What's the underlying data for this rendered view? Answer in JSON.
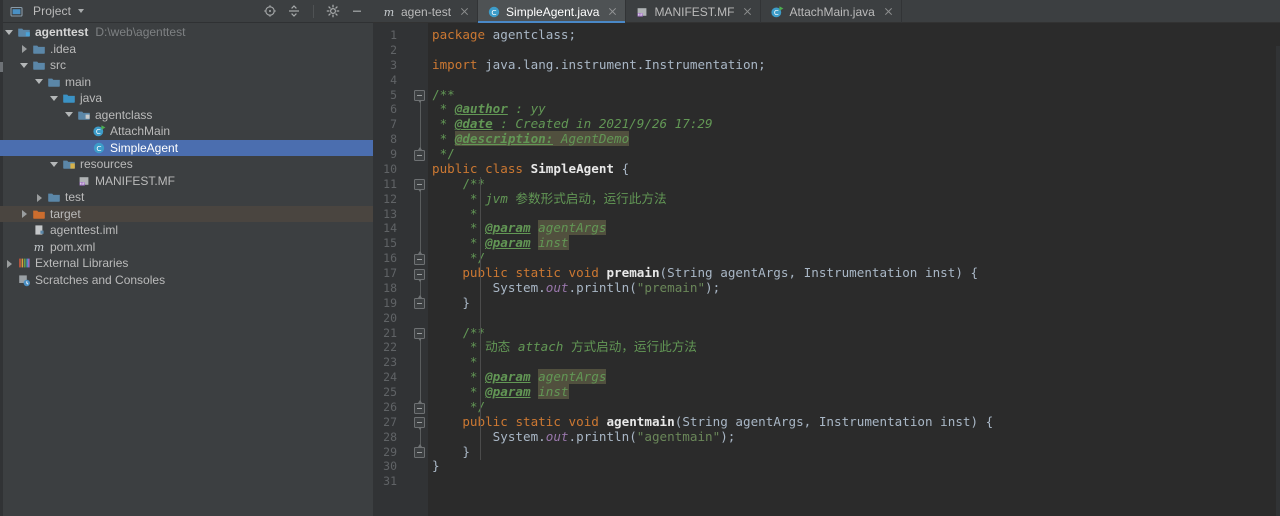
{
  "window": {
    "theme_bg": "#3c3f41",
    "editor_bg": "#2b2b2b",
    "accent": "#4b6eaf"
  },
  "sidebar": {
    "title": "Project",
    "actions": [
      {
        "name": "locate-icon",
        "tooltip": "Select Opened File"
      },
      {
        "name": "collapse-all-icon",
        "tooltip": "Collapse All"
      },
      {
        "name": "gear-icon",
        "tooltip": "Settings"
      },
      {
        "name": "minimize-icon",
        "tooltip": "Hide"
      }
    ],
    "tree": [
      {
        "label": "agenttest",
        "sub": "D:\\web\\agenttest",
        "depth": 0,
        "arrow": "open",
        "icon": "module-icon",
        "state": "bold"
      },
      {
        "label": ".idea",
        "sub": "",
        "depth": 1,
        "arrow": "closed",
        "icon": "folder-icon",
        "state": "normal"
      },
      {
        "label": "src",
        "sub": "",
        "depth": 1,
        "arrow": "open",
        "icon": "folder-icon",
        "state": "normal"
      },
      {
        "label": "main",
        "sub": "",
        "depth": 2,
        "arrow": "open",
        "icon": "folder-icon",
        "state": "normal"
      },
      {
        "label": "java",
        "sub": "",
        "depth": 3,
        "arrow": "open",
        "icon": "source-root-icon",
        "state": "normal"
      },
      {
        "label": "agentclass",
        "sub": "",
        "depth": 4,
        "arrow": "open",
        "icon": "package-icon",
        "state": "normal"
      },
      {
        "label": "AttachMain",
        "sub": "",
        "depth": 5,
        "arrow": "none",
        "icon": "java-class-runnable-icon",
        "state": "normal"
      },
      {
        "label": "SimpleAgent",
        "sub": "",
        "depth": 5,
        "arrow": "none",
        "icon": "java-class-icon",
        "state": "selected"
      },
      {
        "label": "resources",
        "sub": "",
        "depth": 3,
        "arrow": "open",
        "icon": "resource-root-icon",
        "state": "normal"
      },
      {
        "label": "MANIFEST.MF",
        "sub": "",
        "depth": 4,
        "arrow": "none",
        "icon": "manifest-icon",
        "state": "normal"
      },
      {
        "label": "test",
        "sub": "",
        "depth": 2,
        "arrow": "closed",
        "icon": "folder-icon",
        "state": "normal"
      },
      {
        "label": "target",
        "sub": "",
        "depth": 1,
        "arrow": "closed",
        "icon": "excluded-folder-icon",
        "state": "hovered"
      },
      {
        "label": "agenttest.iml",
        "sub": "",
        "depth": 1,
        "arrow": "none",
        "icon": "iml-file-icon",
        "state": "normal"
      },
      {
        "label": "pom.xml",
        "sub": "",
        "depth": 1,
        "arrow": "none",
        "icon": "maven-icon",
        "state": "normal"
      },
      {
        "label": "External Libraries",
        "sub": "",
        "depth": 0,
        "arrow": "closed",
        "icon": "libraries-icon",
        "state": "normal"
      },
      {
        "label": "Scratches and Consoles",
        "sub": "",
        "depth": 0,
        "arrow": "none",
        "icon": "scratches-icon",
        "state": "normal"
      }
    ]
  },
  "tabs": [
    {
      "label": "agen-test",
      "icon": "maven-icon",
      "active": false
    },
    {
      "label": "SimpleAgent.java",
      "icon": "java-class-icon",
      "active": true
    },
    {
      "label": "MANIFEST.MF",
      "icon": "manifest-icon",
      "active": false
    },
    {
      "label": "AttachMain.java",
      "icon": "java-class-runnable-icon",
      "active": false
    }
  ],
  "editor": {
    "file": "SimpleAgent.java",
    "first_line": 1,
    "last_line": 31,
    "line_numbers": [
      1,
      2,
      3,
      4,
      5,
      6,
      7,
      8,
      9,
      10,
      11,
      12,
      13,
      14,
      15,
      16,
      17,
      18,
      19,
      20,
      21,
      22,
      23,
      24,
      25,
      26,
      27,
      28,
      29,
      30,
      31
    ],
    "lines": [
      "package agentclass;",
      "",
      "import java.lang.instrument.Instrumentation;",
      "",
      "/**",
      " * @author : yy",
      " * @date : Created in 2021/9/26 17:29",
      " * @description: AgentDemo",
      " */",
      "public class SimpleAgent {",
      "    /**",
      "     * jvm 参数形式启动，运行此方法",
      "     *",
      "     * @param agentArgs",
      "     * @param inst",
      "     */",
      "    public static void premain(String agentArgs, Instrumentation inst) {",
      "        System.out.println(\"premain\");",
      "    }",
      "",
      "    /**",
      "     * 动态 attach 方式启动，运行此方法",
      "     *",
      "     * @param agentArgs",
      "     * @param inst",
      "     */",
      "    public static void agentmain(String agentArgs, Instrumentation inst) {",
      "        System.out.println(\"agentmain\");",
      "    }",
      "}",
      ""
    ],
    "fold_markers": [
      {
        "line": 5,
        "type": "start"
      },
      {
        "line": 9,
        "type": "end"
      },
      {
        "line": 11,
        "type": "start"
      },
      {
        "line": 16,
        "type": "end"
      },
      {
        "line": 17,
        "type": "start"
      },
      {
        "line": 19,
        "type": "end"
      },
      {
        "line": 21,
        "type": "start"
      },
      {
        "line": 26,
        "type": "end"
      },
      {
        "line": 27,
        "type": "start"
      },
      {
        "line": 29,
        "type": "end"
      }
    ],
    "syntax_colors": {
      "keyword": "#cc7832",
      "string": "#6a8759",
      "comment": "#629755",
      "method": "#ffc66d",
      "field": "#9876aa",
      "default": "#a9b7c6",
      "highlight": "#51503e"
    }
  }
}
